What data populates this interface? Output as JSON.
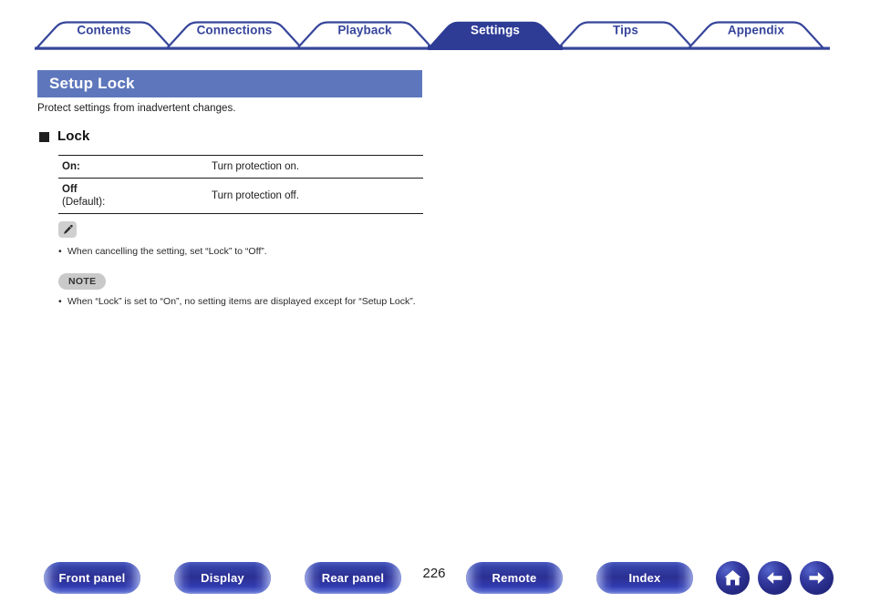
{
  "nav_tabs": [
    {
      "label": "Contents",
      "active": false
    },
    {
      "label": "Connections",
      "active": false
    },
    {
      "label": "Playback",
      "active": false
    },
    {
      "label": "Settings",
      "active": true
    },
    {
      "label": "Tips",
      "active": false
    },
    {
      "label": "Appendix",
      "active": false
    }
  ],
  "page": {
    "title": "Setup Lock",
    "intro": "Protect settings from inadvertent changes.",
    "section_heading": "Lock"
  },
  "spec_table": {
    "rows": [
      {
        "key_bold": "On",
        "key_suffix": ":",
        "key_sub": "",
        "desc": "Turn protection on."
      },
      {
        "key_bold": "Off",
        "key_suffix": "",
        "key_sub": "(Default):",
        "desc": "Turn protection off."
      }
    ]
  },
  "tip": {
    "icon": "pencil-icon",
    "bullets": [
      "When cancelling the setting, set “Lock” to “Off”."
    ]
  },
  "note": {
    "label": "NOTE",
    "bullets": [
      "When “Lock” is set to “On”, no setting items are displayed except for “Setup Lock”."
    ]
  },
  "footer": {
    "buttons": [
      {
        "label": "Front panel"
      },
      {
        "label": "Display"
      },
      {
        "label": "Rear panel"
      },
      {
        "label": "Remote"
      },
      {
        "label": "Index"
      }
    ],
    "page_number": "226",
    "icon_buttons": [
      {
        "name": "home-icon"
      },
      {
        "name": "arrow-left-icon"
      },
      {
        "name": "arrow-right-icon"
      }
    ]
  },
  "colors": {
    "tab_blue": "#36459b",
    "tab_active_fill": "#2e3c96",
    "title_bar_blue": "#5e77bc",
    "rule_black": "#1c1c1c",
    "note_gray": "#c9c9c9"
  }
}
